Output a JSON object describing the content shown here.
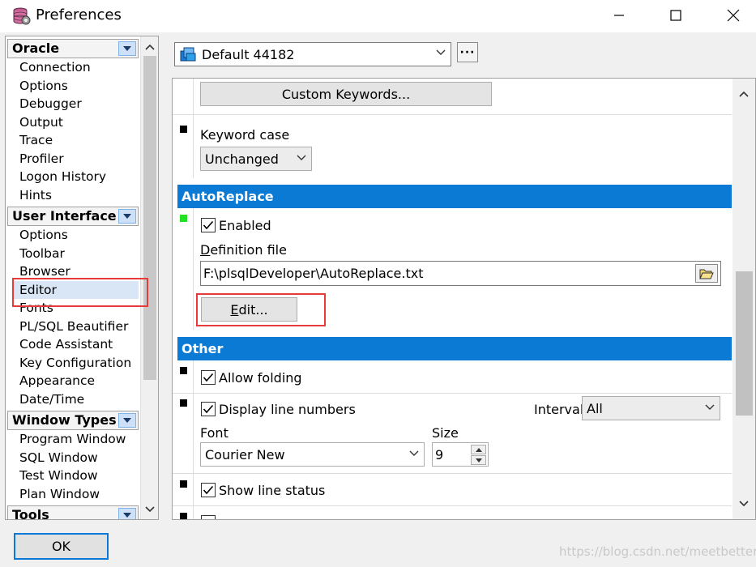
{
  "window": {
    "title": "Preferences",
    "controls": {
      "minimize": "minimize",
      "maximize": "maximize",
      "close": "close"
    }
  },
  "nav": {
    "groups": [
      {
        "label": "Oracle",
        "items": [
          "Connection",
          "Options",
          "Debugger",
          "Output",
          "Trace",
          "Profiler",
          "Logon History",
          "Hints"
        ]
      },
      {
        "label": "User Interface",
        "items": [
          "Options",
          "Toolbar",
          "Browser",
          "Editor",
          "Fonts",
          "PL/SQL Beautifier",
          "Code Assistant",
          "Key Configuration",
          "Appearance",
          "Date/Time"
        ]
      },
      {
        "label": "Window Types",
        "items": [
          "Program Window",
          "SQL Window",
          "Test Window",
          "Plan Window"
        ]
      },
      {
        "label": "Tools",
        "items": []
      }
    ],
    "selected": "Editor"
  },
  "profile": {
    "value": "Default 44182",
    "more_label": "···"
  },
  "settings": {
    "custom_keywords_button": "Custom Keywords...",
    "keyword_case": {
      "label": "Keyword case",
      "value": "Unchanged"
    },
    "autoreplace": {
      "header": "AutoReplace",
      "enabled_label": "Enabled",
      "enabled": true,
      "definition_file_label_accel": "D",
      "definition_file_label_rest": "efinition file",
      "definition_file_value": "F:\\plsqlDeveloper\\AutoReplace.txt",
      "edit_button_accel": "E",
      "edit_button_rest": "dit..."
    },
    "other": {
      "header": "Other",
      "allow_folding_label": "Allow folding",
      "allow_folding": true,
      "display_line_numbers_label": "Display line numbers",
      "display_line_numbers": true,
      "interval_label": "Interval",
      "interval_value": "All",
      "font_label": "Font",
      "font_value": "Courier New",
      "size_label": "Size",
      "size_value": "9",
      "show_line_status_label": "Show line status",
      "show_line_status": true
    }
  },
  "footer": {
    "ok_label": "OK",
    "watermark": "https://blog.csdn.net/meetbetterhc"
  },
  "colors": {
    "section_header": "#0a7ad4",
    "highlight_box": "#e53b3b",
    "ok_border": "#0a78d7",
    "enabled_marker": "#22e022"
  }
}
